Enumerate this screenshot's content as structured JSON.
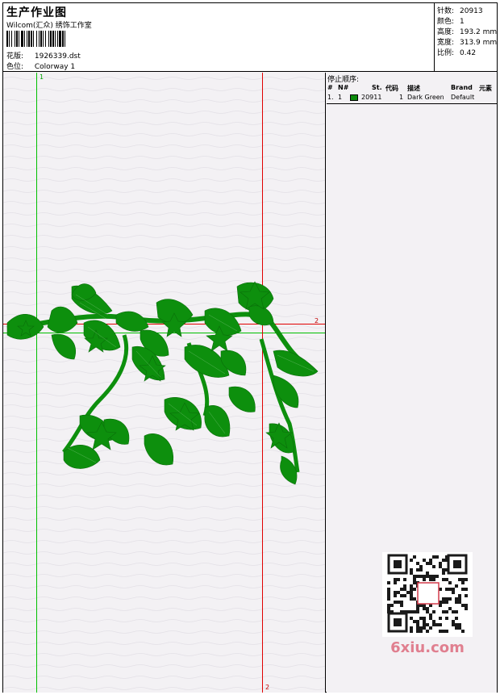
{
  "header": {
    "title": "生产作业图",
    "company": "Wilcom(汇众) 绣饰工作室",
    "pattern_label": "花版:",
    "pattern_value": "1926339.dst",
    "colorway_label": "色位:",
    "colorway_value": "Colorway 1"
  },
  "stats": [
    {
      "label": "针数:",
      "value": "20913"
    },
    {
      "label": "颜色:",
      "value": "1"
    },
    {
      "label": "高度:",
      "value": "193.2 mm"
    },
    {
      "label": "宽度:",
      "value": "313.9 mm"
    },
    {
      "label": "比例:",
      "value": "0.42"
    }
  ],
  "markers": {
    "green_v": "1",
    "red_h": "2",
    "red_v": "2"
  },
  "stop_sequence": {
    "title": "停止顺序:",
    "headers": {
      "num": "#",
      "needle": "N#",
      "stitches": "St.",
      "code": "代码",
      "description": "描述",
      "brand": "Brand",
      "element": "元素"
    },
    "rows": [
      {
        "num": "1.",
        "needle": "1",
        "stitches": "20911",
        "code": "1",
        "description": "Dark Green",
        "brand": "Default",
        "color": "#0b8a0b"
      }
    ]
  },
  "watermark": {
    "text": "6xiu.com",
    "seal": "汉何图库"
  },
  "colors": {
    "embroidery": "#0d8f0d",
    "guide_green": "#00c000",
    "guide_red": "#e00000"
  }
}
